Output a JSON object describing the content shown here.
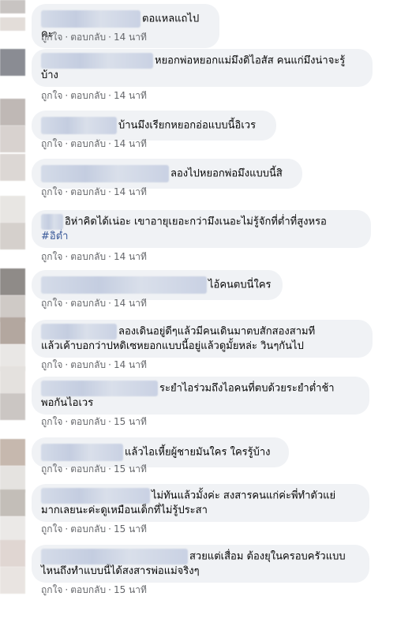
{
  "colors": {
    "bubble": "#f0f2f5",
    "meta_text": "#65676b",
    "hashtag": "#385898"
  },
  "actions": {
    "like": "ถูกใจ",
    "reply": "ตอบกลับ",
    "separator": "·"
  },
  "comments": [
    {
      "text": "ตอแหลแถไปคะ",
      "time": "14 นาที"
    },
    {
      "text": "หยอกพ่อหยอกแม่มึงดิไอสัส คนแก่มึงน่าจะรู้ บ้าง",
      "line1": "หยอกพ่อหยอกแม่มึงดิไอสัส คนแก่มึงน่าจะรู้",
      "line2": "บ้าง",
      "time": "14 นาที"
    },
    {
      "text": "บ้านมึงเรียกหยอกอ่อแบบนี้อิเวร",
      "time": "14 นาที"
    },
    {
      "text": "ลองไปหยอกพ่อมึงแบบนี้สิ",
      "time": "14 นาที"
    },
    {
      "line1": "อิห่าคิดได้เน่อะ เขาอายุเยอะกว่ามึงเนอะไม่รู้จักที่ต่ำที่สูงหรอ",
      "hashtag": "#อิต่ำ",
      "time": "14 นาที"
    },
    {
      "text": "ไอ้คนตบนี่ใคร",
      "time": "14 นาที"
    },
    {
      "line1": "ลองเดินอยู่ดีๆแล้วมีคนเดินมาตบสักสองสามที",
      "line2": "แล้วเค้าบอกว่าปหดิเซหยอกแบบนี้อยู่แล้วดูมั้ยหล่ะ วินๆกันไป",
      "time": "14 นาที"
    },
    {
      "line1": "ระยำไอร่วมถึงไอคนที่ตบด้วยระยำต่ำช้า",
      "line2": "พอกันไอเวร",
      "time": "15 นาที"
    },
    {
      "text": "แล้วไอเหี้ยผู้ชายมันใคร ใครรู้บ้าง",
      "time": "15 นาที"
    },
    {
      "line1": "ไม่ทันแล้วมั้งค่ะ สงสารคนแก่ค่ะพี่ทำตัวแย่",
      "line2": "มากเลยนะค่ะดูเหมือนเด็กที่ไม่รู้ประสา",
      "time": "15 นาที"
    },
    {
      "line1": "สวยแต่เสื่อม ต้องยุในครอบครัวแบบ",
      "line2": "ไหนถึงทำแบบนี้ได้สงสารพ่อแม่จริงๆ",
      "time": "15 นาที"
    }
  ]
}
